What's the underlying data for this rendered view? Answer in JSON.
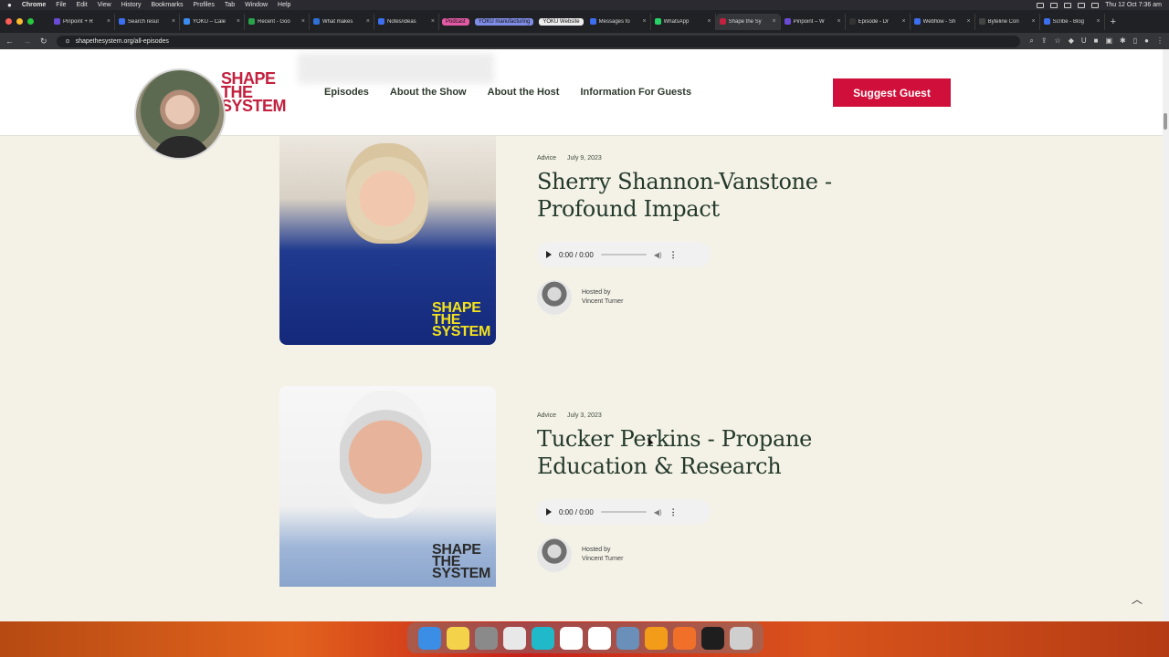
{
  "menubar": {
    "apple": "",
    "items": [
      "Chrome",
      "File",
      "Edit",
      "View",
      "History",
      "Bookmarks",
      "Profiles",
      "Tab",
      "Window",
      "Help"
    ],
    "clock": "Thu 12 Oct  7:36 am"
  },
  "tabs": [
    {
      "label": "Pinpoint + R",
      "color": "#6a4bd6"
    },
    {
      "label": "Search resul",
      "color": "#3c6ff0"
    },
    {
      "label": "YOKU – Cale",
      "color": "#3c8cf0"
    },
    {
      "label": "Recent - Goo",
      "color": "#2aa34a"
    },
    {
      "label": "What makes",
      "color": "#2f6fd6"
    },
    {
      "label": "Notes/ideas",
      "color": "#3c6ff0"
    },
    {
      "label": "Podcast",
      "pill": "#e35aa5"
    },
    {
      "label": "YOKU manufacturing",
      "pill": "#7f8de6"
    },
    {
      "label": "YOKU Website",
      "pill": "#ededed"
    },
    {
      "label": "Messages fo",
      "color": "#3c6ff0"
    },
    {
      "label": "WhatsApp",
      "color": "#25d366"
    },
    {
      "label": "Shape the Sy",
      "color": "#c2213f",
      "active": true
    },
    {
      "label": "Pinpoint – W",
      "color": "#6a4bd6"
    },
    {
      "label": "Episode - Dr",
      "color": "#333333"
    },
    {
      "label": "Webflow - Sh",
      "color": "#3c6ff0"
    },
    {
      "label": "Byteline Con",
      "color": "#444444"
    },
    {
      "label": "Scribe - Blog",
      "color": "#3c6ff0"
    }
  ],
  "address": {
    "url": "shapethesystem.org/all-episodes"
  },
  "site": {
    "logo_line1": "SHAPE",
    "logo_line2": "THE",
    "logo_line3": "SYSTEM",
    "nav": [
      "Episodes",
      "About the Show",
      "About the Host",
      "Information For Guests"
    ],
    "cta": "Suggest Guest"
  },
  "episodes": [
    {
      "category": "Advice",
      "date": "July 9, 2023",
      "title": "Sherry Shannon-Vanstone - Profound Impact",
      "time": "0:00 / 0:00",
      "hosted_by": "Hosted by",
      "host": "Vincent Turner",
      "brand_line1": "SHAPE",
      "brand_line2": "THE",
      "brand_line3": "SYSTEM"
    },
    {
      "category": "Advice",
      "date": "July 3, 2023",
      "title": "Tucker Perkins - Propane Education & Research",
      "time": "0:00 / 0:00",
      "hosted_by": "Hosted by",
      "host": "Vincent Turner",
      "brand_line1": "SHAPE",
      "brand_line2": "THE",
      "brand_line3": "SYSTEM"
    }
  ],
  "dock": [
    {
      "name": "finder",
      "color": "#3a8ee6"
    },
    {
      "name": "notes",
      "color": "#f4d34a"
    },
    {
      "name": "system-settings",
      "color": "#8a8a8a"
    },
    {
      "name": "chrome",
      "color": "#e8e8e8"
    },
    {
      "name": "canva",
      "color": "#20b9c9"
    },
    {
      "name": "slack",
      "color": "#ffffff"
    },
    {
      "name": "face",
      "color": "#ffffff"
    },
    {
      "name": "preview",
      "color": "#6a8fb8"
    },
    {
      "name": "sublime",
      "color": "#f39c1a"
    },
    {
      "name": "pencil",
      "color": "#f0702a"
    },
    {
      "name": "figma",
      "color": "#1e1e1e"
    },
    {
      "name": "trash",
      "color": "#cfcfcf"
    }
  ]
}
